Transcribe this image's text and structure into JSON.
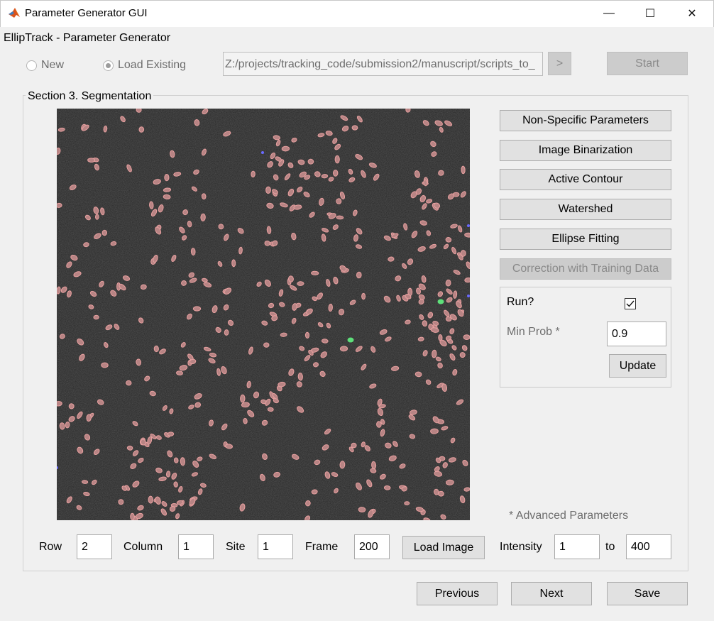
{
  "window": {
    "title": "Parameter Generator GUI",
    "controls": [
      "—",
      "☐",
      "✕"
    ]
  },
  "app_label": "EllipTrack - Parameter Generator",
  "mode": {
    "new_label": "New",
    "load_label": "Load Existing",
    "selected": "load"
  },
  "path": {
    "value": "Z:/projects/tracking_code/submission2/manuscript/scripts_to_",
    "browse_label": ">"
  },
  "start_label": "Start",
  "section_title": "Section 3. Segmentation",
  "side_buttons": [
    {
      "label": "Non-Specific Parameters",
      "enabled": true
    },
    {
      "label": "Image Binarization",
      "enabled": true
    },
    {
      "label": "Active Contour",
      "enabled": true
    },
    {
      "label": "Watershed",
      "enabled": true
    },
    {
      "label": "Ellipse Fitting",
      "enabled": true
    },
    {
      "label": "Correction with Training Data",
      "enabled": false
    }
  ],
  "training": {
    "run_label": "Run?",
    "run_checked": true,
    "min_prob_label": "Min Prob *",
    "min_prob_value": "0.9",
    "update_label": "Update"
  },
  "advanced_note": "* Advanced Parameters",
  "image_controls": {
    "row_label": "Row",
    "row_value": "2",
    "column_label": "Column",
    "column_value": "1",
    "site_label": "Site",
    "site_value": "1",
    "frame_label": "Frame",
    "frame_value": "200",
    "load_label": "Load Image",
    "intensity_label": "Intensity",
    "intensity_min": "1",
    "to_label": "to",
    "intensity_max": "400"
  },
  "nav": {
    "previous_label": "Previous",
    "next_label": "Next",
    "save_label": "Save"
  },
  "colors": {
    "ellipse": "#e8a0a0",
    "ellipse_fill": "#b88484",
    "green": "#5ee07a",
    "blue": "#6a6aff"
  }
}
